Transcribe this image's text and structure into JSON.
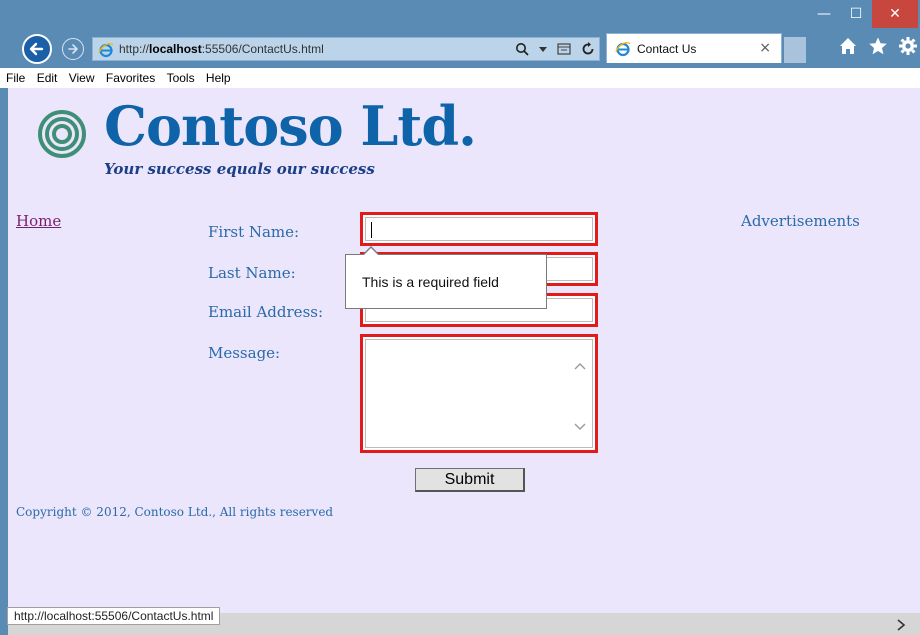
{
  "window": {
    "minimize_symbol": "—",
    "maximize_symbol": "☐",
    "close_symbol": "✕"
  },
  "browser": {
    "url_prefix": "http://",
    "url_host": "localhost",
    "url_rest": ":55506/ContactUs.html",
    "tab_title": "Contact Us",
    "tab_close": "×"
  },
  "menu": {
    "items": [
      "File",
      "Edit",
      "View",
      "Favorites",
      "Tools",
      "Help"
    ]
  },
  "page": {
    "brand": "Contoso Ltd.",
    "tagline": "Your success equals our success",
    "nav_home": "Home",
    "ads_label": "Advertisements",
    "form": {
      "first_name_label": "First Name:",
      "last_name_label": "Last Name:",
      "email_label": "Email Address:",
      "message_label": "Message:",
      "first_name_value": "",
      "last_name_value": "",
      "email_value": "",
      "message_value": "",
      "submit_label": "Submit"
    },
    "tooltip": "This is a required field",
    "copyright": "Copyright © 2012, Contoso Ltd., All rights reserved"
  },
  "status": {
    "hover_url": "http://localhost:55506/ContactUs.html"
  },
  "colors": {
    "chrome": "#5a8bb5",
    "page_bg": "#ebe6fc",
    "brand": "#0f63a8",
    "error_border": "#e11a1a",
    "label": "#2a6aa8"
  }
}
